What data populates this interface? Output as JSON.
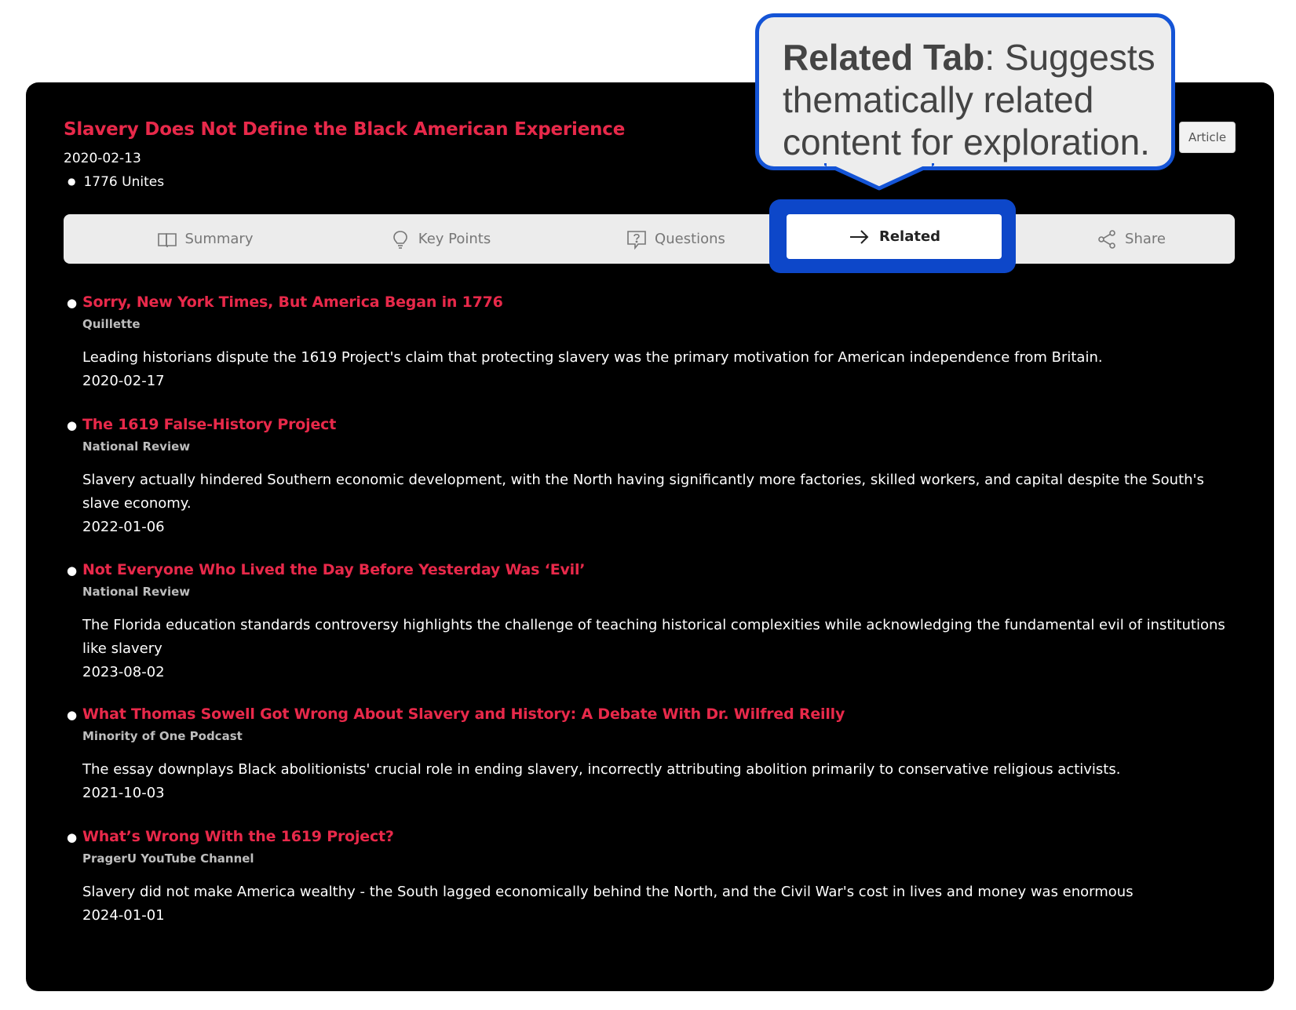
{
  "article": {
    "title": "Slavery Does Not Define the Black American Experience",
    "date": "2020-02-13",
    "source": "1776 Unites",
    "badge": "Article"
  },
  "tabs": [
    {
      "label": "Summary",
      "icon": "book-icon"
    },
    {
      "label": "Key Points",
      "icon": "lightbulb-icon"
    },
    {
      "label": "Questions",
      "icon": "question-icon"
    },
    {
      "label": "Related",
      "icon": "arrow-right-icon",
      "active": true
    },
    {
      "label": "Share",
      "icon": "share-icon"
    }
  ],
  "callout": {
    "bold": "Related Tab",
    "text": ": Suggests thematically related content for exploration."
  },
  "related": [
    {
      "title": "Sorry, New York Times, But America Began in 1776",
      "source": "Quillette",
      "description": "Leading historians dispute the 1619 Project's claim that protecting slavery was the primary motivation for American independence from Britain.",
      "date": "2020-02-17"
    },
    {
      "title": "The 1619 False-History Project",
      "source": "National Review",
      "description": "Slavery actually hindered Southern economic development, with the North having significantly more factories, skilled workers, and capital despite the South's slave economy.",
      "date": "2022-01-06"
    },
    {
      "title": "Not Everyone Who Lived the Day Before Yesterday Was ‘Evil’",
      "source": "National Review",
      "description": "The Florida education standards controversy highlights the challenge of teaching historical complexities while acknowledging the fundamental evil of institutions like slavery",
      "date": "2023-08-02"
    },
    {
      "title": "What Thomas Sowell Got Wrong About Slavery and History: A Debate With Dr. Wilfred Reilly",
      "source": "Minority of One Podcast",
      "description": "The essay downplays Black abolitionists' crucial role in ending slavery, incorrectly attributing abolition primarily to conservative religious activists.",
      "date": "2021-10-03"
    },
    {
      "title": "What’s Wrong With the 1619 Project?",
      "source": "PragerU YouTube Channel",
      "description": "Slavery did not make America wealthy - the South lagged economically behind the North, and the Civil War's cost in lives and money was enormous",
      "date": "2024-01-01"
    }
  ],
  "colors": {
    "accent": "#e8294a",
    "highlight": "#0d47c9",
    "background": "#000000"
  }
}
